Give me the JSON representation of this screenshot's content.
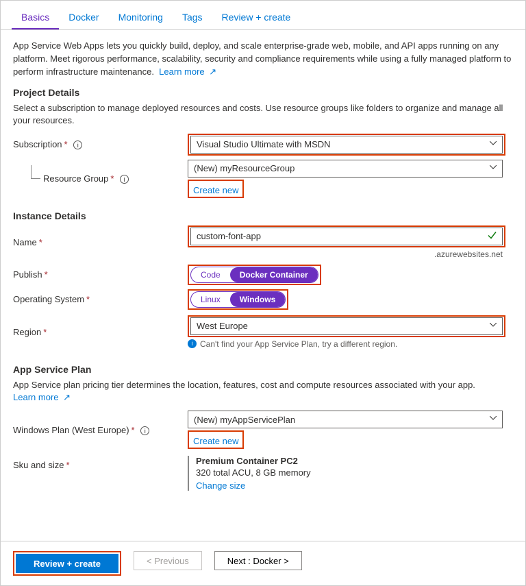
{
  "tabs": [
    "Basics",
    "Docker",
    "Monitoring",
    "Tags",
    "Review + create"
  ],
  "intro": "App Service Web Apps lets you quickly build, deploy, and scale enterprise-grade web, mobile, and API apps running on any platform. Meet rigorous performance, scalability, security and compliance requirements while using a fully managed platform to perform infrastructure maintenance.",
  "learn_more": "Learn more",
  "project": {
    "heading": "Project Details",
    "desc": "Select a subscription to manage deployed resources and costs. Use resource groups like folders to organize and manage all your resources.",
    "subscription_label": "Subscription",
    "subscription_value": "Visual Studio Ultimate with MSDN",
    "rg_label": "Resource Group",
    "rg_value": "(New) myResourceGroup",
    "create_new": "Create new"
  },
  "instance": {
    "heading": "Instance Details",
    "name_label": "Name",
    "name_value": "custom-font-app",
    "name_suffix": ".azurewebsites.net",
    "publish_label": "Publish",
    "publish_options": [
      "Code",
      "Docker Container"
    ],
    "os_label": "Operating System",
    "os_options": [
      "Linux",
      "Windows"
    ],
    "region_label": "Region",
    "region_value": "West Europe",
    "region_hint": "Can't find your App Service Plan, try a different region."
  },
  "plan": {
    "heading": "App Service Plan",
    "desc": "App Service plan pricing tier determines the location, features, cost and compute resources associated with your app.",
    "plan_label": "Windows Plan (West Europe)",
    "plan_value": "(New) myAppServicePlan",
    "create_new": "Create new",
    "sku_label": "Sku and size",
    "sku_name": "Premium Container PC2",
    "sku_desc": "320 total ACU, 8 GB memory",
    "change_size": "Change size"
  },
  "footer": {
    "review": "Review + create",
    "prev": "<  Previous",
    "next": "Next : Docker  >"
  }
}
